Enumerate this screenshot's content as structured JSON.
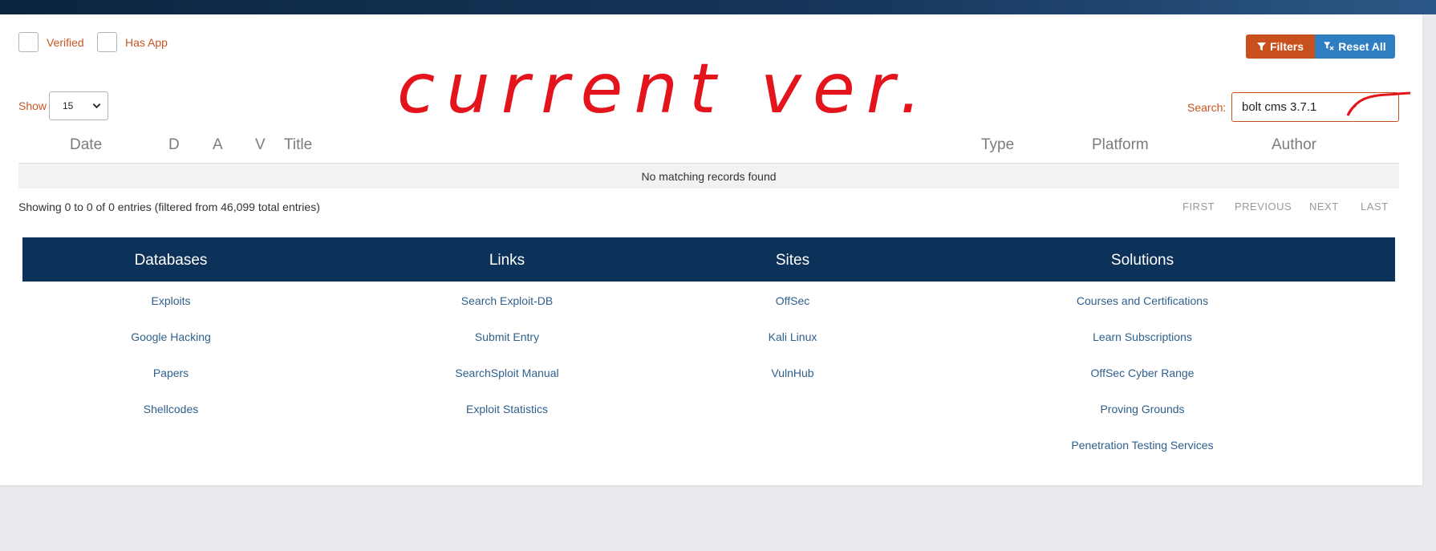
{
  "filters": {
    "verified_label": "Verified",
    "has_app_label": "Has App",
    "filters_button": "Filters",
    "reset_button": "Reset All"
  },
  "table_controls": {
    "show_label": "Show",
    "show_value": "15",
    "search_label": "Search:",
    "search_value": "bolt cms 3.7.1"
  },
  "annotation": {
    "handwritten_text": "current ver."
  },
  "table": {
    "columns": [
      "Date",
      "D",
      "A",
      "V",
      "Title",
      "Type",
      "Platform",
      "Author"
    ],
    "empty_message": "No matching records found",
    "info": "Showing 0 to 0 of 0 entries (filtered from 46,099 total entries)",
    "pager": [
      "FIRST",
      "PREVIOUS",
      "NEXT",
      "LAST"
    ]
  },
  "footer": {
    "columns": [
      {
        "heading": "Databases",
        "links": [
          "Exploits",
          "Google Hacking",
          "Papers",
          "Shellcodes"
        ]
      },
      {
        "heading": "Links",
        "links": [
          "Search Exploit-DB",
          "Submit Entry",
          "SearchSploit Manual",
          "Exploit Statistics"
        ]
      },
      {
        "heading": "Sites",
        "links": [
          "OffSec",
          "Kali Linux",
          "VulnHub"
        ]
      },
      {
        "heading": "Solutions",
        "links": [
          "Courses and Certifications",
          "Learn Subscriptions",
          "OffSec Cyber Range",
          "Proving Grounds",
          "Penetration Testing Services"
        ]
      }
    ]
  },
  "colors": {
    "accent_orange": "#c8501c",
    "accent_blue": "#2f7ec2",
    "footer_navy": "#0c3259",
    "annotation_red": "#e3141b"
  },
  "icons": {
    "filters_icon": "funnel-icon",
    "reset_icon": "funnel-clear-icon"
  }
}
